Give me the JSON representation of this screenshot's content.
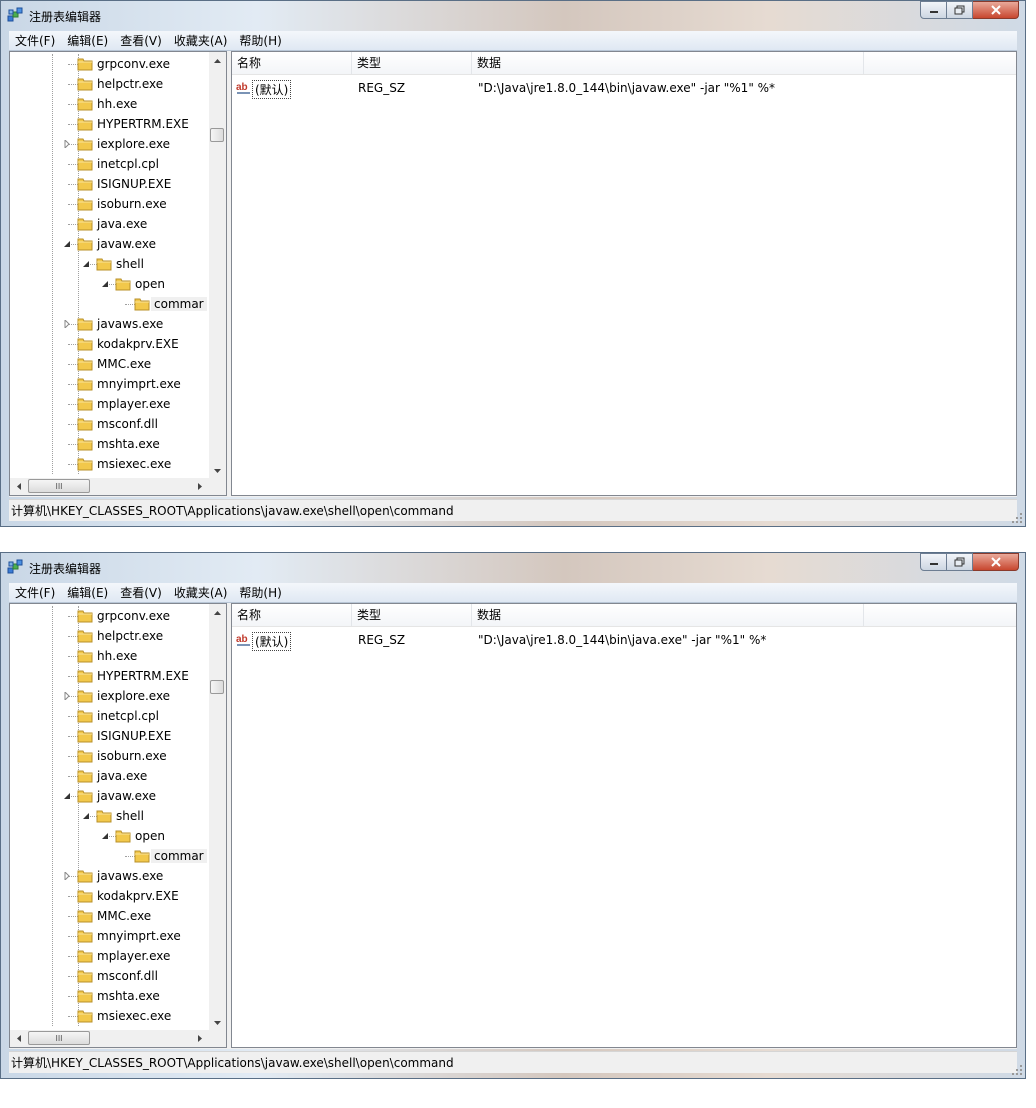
{
  "windows": [
    {
      "title": "注册表编辑器",
      "menu": [
        "文件(F)",
        "编辑(E)",
        "查看(V)",
        "收藏夹(A)",
        "帮助(H)"
      ],
      "tree": [
        {
          "label": "grpconv.exe",
          "depth": 0,
          "expander": "none"
        },
        {
          "label": "helpctr.exe",
          "depth": 0,
          "expander": "none"
        },
        {
          "label": "hh.exe",
          "depth": 0,
          "expander": "none"
        },
        {
          "label": "HYPERTRM.EXE",
          "depth": 0,
          "expander": "none"
        },
        {
          "label": "iexplore.exe",
          "depth": 0,
          "expander": "collapsed"
        },
        {
          "label": "inetcpl.cpl",
          "depth": 0,
          "expander": "none"
        },
        {
          "label": "ISIGNUP.EXE",
          "depth": 0,
          "expander": "none"
        },
        {
          "label": "isoburn.exe",
          "depth": 0,
          "expander": "none"
        },
        {
          "label": "java.exe",
          "depth": 0,
          "expander": "none"
        },
        {
          "label": "javaw.exe",
          "depth": 0,
          "expander": "expanded"
        },
        {
          "label": "shell",
          "depth": 1,
          "expander": "expanded"
        },
        {
          "label": "open",
          "depth": 2,
          "expander": "expanded"
        },
        {
          "label": "commar",
          "depth": 3,
          "expander": "none",
          "selected": true
        },
        {
          "label": "javaws.exe",
          "depth": 0,
          "expander": "collapsed"
        },
        {
          "label": "kodakprv.EXE",
          "depth": 0,
          "expander": "none"
        },
        {
          "label": "MMC.exe",
          "depth": 0,
          "expander": "none"
        },
        {
          "label": "mnyimprt.exe",
          "depth": 0,
          "expander": "none"
        },
        {
          "label": "mplayer.exe",
          "depth": 0,
          "expander": "none"
        },
        {
          "label": "msconf.dll",
          "depth": 0,
          "expander": "none"
        },
        {
          "label": "mshta.exe",
          "depth": 0,
          "expander": "none"
        },
        {
          "label": "msiexec.exe",
          "depth": 0,
          "expander": "none"
        }
      ],
      "hscroll_thumb": "III",
      "columns": [
        "名称",
        "类型",
        "数据"
      ],
      "values": [
        {
          "name": "(默认)",
          "type": "REG_SZ",
          "data": "\"D:\\Java\\jre1.8.0_144\\bin\\javaw.exe\" -jar \"%1\" %*"
        }
      ],
      "status": "计算机\\HKEY_CLASSES_ROOT\\Applications\\javaw.exe\\shell\\open\\command"
    },
    {
      "title": "注册表编辑器",
      "menu": [
        "文件(F)",
        "编辑(E)",
        "查看(V)",
        "收藏夹(A)",
        "帮助(H)"
      ],
      "tree": [
        {
          "label": "grpconv.exe",
          "depth": 0,
          "expander": "none"
        },
        {
          "label": "helpctr.exe",
          "depth": 0,
          "expander": "none"
        },
        {
          "label": "hh.exe",
          "depth": 0,
          "expander": "none"
        },
        {
          "label": "HYPERTRM.EXE",
          "depth": 0,
          "expander": "none"
        },
        {
          "label": "iexplore.exe",
          "depth": 0,
          "expander": "collapsed"
        },
        {
          "label": "inetcpl.cpl",
          "depth": 0,
          "expander": "none"
        },
        {
          "label": "ISIGNUP.EXE",
          "depth": 0,
          "expander": "none"
        },
        {
          "label": "isoburn.exe",
          "depth": 0,
          "expander": "none"
        },
        {
          "label": "java.exe",
          "depth": 0,
          "expander": "none"
        },
        {
          "label": "javaw.exe",
          "depth": 0,
          "expander": "expanded"
        },
        {
          "label": "shell",
          "depth": 1,
          "expander": "expanded"
        },
        {
          "label": "open",
          "depth": 2,
          "expander": "expanded"
        },
        {
          "label": "commar",
          "depth": 3,
          "expander": "none",
          "selected": true
        },
        {
          "label": "javaws.exe",
          "depth": 0,
          "expander": "collapsed"
        },
        {
          "label": "kodakprv.EXE",
          "depth": 0,
          "expander": "none"
        },
        {
          "label": "MMC.exe",
          "depth": 0,
          "expander": "none"
        },
        {
          "label": "mnyimprt.exe",
          "depth": 0,
          "expander": "none"
        },
        {
          "label": "mplayer.exe",
          "depth": 0,
          "expander": "none"
        },
        {
          "label": "msconf.dll",
          "depth": 0,
          "expander": "none"
        },
        {
          "label": "mshta.exe",
          "depth": 0,
          "expander": "none"
        },
        {
          "label": "msiexec.exe",
          "depth": 0,
          "expander": "none"
        }
      ],
      "hscroll_thumb": "III",
      "columns": [
        "名称",
        "类型",
        "数据"
      ],
      "values": [
        {
          "name": "(默认)",
          "type": "REG_SZ",
          "data": "\"D:\\Java\\jre1.8.0_144\\bin\\java.exe\" -jar \"%1\" %*"
        }
      ],
      "status": "计算机\\HKEY_CLASSES_ROOT\\Applications\\javaw.exe\\shell\\open\\command"
    }
  ],
  "icons": {
    "app": "regedit-icon",
    "folder": "folder-icon",
    "value": "string-value-icon"
  },
  "colors": {
    "folder": "#f2c84b",
    "close_button": "#c8472f",
    "string_icon": "#c0392b"
  }
}
